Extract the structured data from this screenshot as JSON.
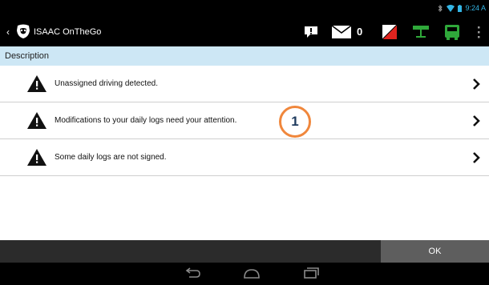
{
  "status_bar": {
    "time": "9:24 A",
    "icons": [
      "bluetooth-icon",
      "wifi-icon",
      "battery-icon"
    ]
  },
  "action_bar": {
    "back_glyph": "‹",
    "app_title": "ISAAC OnTheGo",
    "message_count": "0",
    "icons": [
      "alert-icon",
      "envelope-icon",
      "status-flag-icon",
      "network-icon",
      "truck-icon",
      "overflow-menu-icon"
    ],
    "colors": {
      "accent_green": "#2fa83a",
      "flag_red": "#e0241f"
    }
  },
  "list": {
    "column_header": "Description",
    "items": [
      {
        "label": "Unassigned driving detected.",
        "icon": "warning-icon"
      },
      {
        "label": "Modifications to your daily logs need your attention.",
        "icon": "warning-icon"
      },
      {
        "label": "Some daily logs are not signed.",
        "icon": "warning-icon"
      }
    ]
  },
  "badge": {
    "label": "1",
    "color": "#f0873c"
  },
  "footer": {
    "ok_label": "OK"
  },
  "nav": {
    "icons": [
      "back-nav-icon",
      "home-nav-icon",
      "recents-nav-icon"
    ]
  }
}
